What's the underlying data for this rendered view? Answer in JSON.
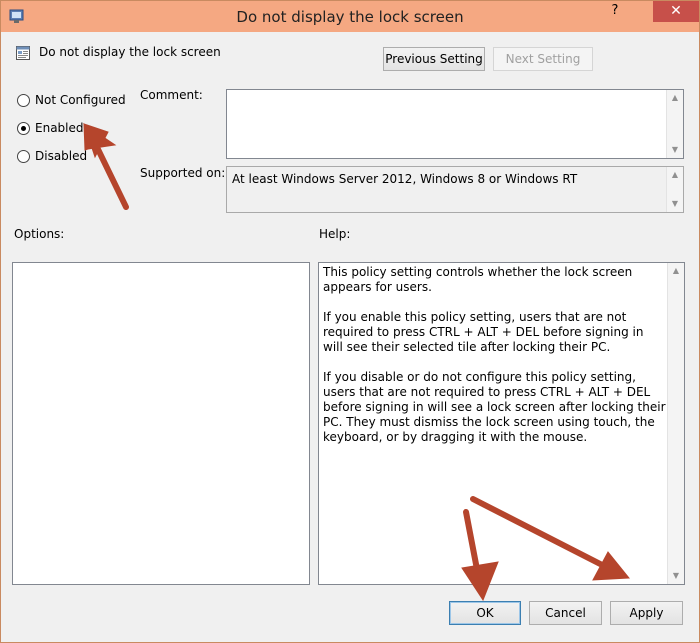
{
  "window": {
    "title": "Do not display the lock screen",
    "help_glyph": "?",
    "close_glyph": "✕"
  },
  "header": {
    "policy_name": "Do not display the lock screen",
    "previous_label": "Previous Setting",
    "next_label": "Next Setting"
  },
  "state": {
    "options": [
      {
        "label": "Not Configured",
        "selected": false
      },
      {
        "label": "Enabled",
        "selected": true
      },
      {
        "label": "Disabled",
        "selected": false
      }
    ]
  },
  "comment": {
    "label": "Comment:",
    "value": ""
  },
  "supported": {
    "label": "Supported on:",
    "value": "At least Windows Server 2012, Windows 8 or Windows RT"
  },
  "options_panel": {
    "label": "Options:"
  },
  "help_panel": {
    "label": "Help:",
    "paragraphs": [
      "This policy setting controls whether the lock screen appears for users.",
      "If you enable this policy setting, users that are not required to press CTRL + ALT + DEL before signing in will see their selected tile after  locking their PC.",
      "If you disable or do not configure this policy setting, users that are not required to press CTRL + ALT + DEL before signing in will see a lock screen after locking their PC. They must dismiss the lock screen using touch, the keyboard, or by dragging it with the mouse."
    ]
  },
  "footer": {
    "ok_label": "OK",
    "cancel_label": "Cancel",
    "apply_label": "Apply"
  },
  "icons": [
    "window-app-icon",
    "help-icon",
    "close-icon",
    "policy-icon",
    "scroll-up-icon",
    "scroll-down-icon",
    "annotation-arrow-icon"
  ],
  "colors": {
    "titlebar": "#f5a882",
    "close": "#c7504a",
    "annotation_arrow": "#b5452c"
  }
}
